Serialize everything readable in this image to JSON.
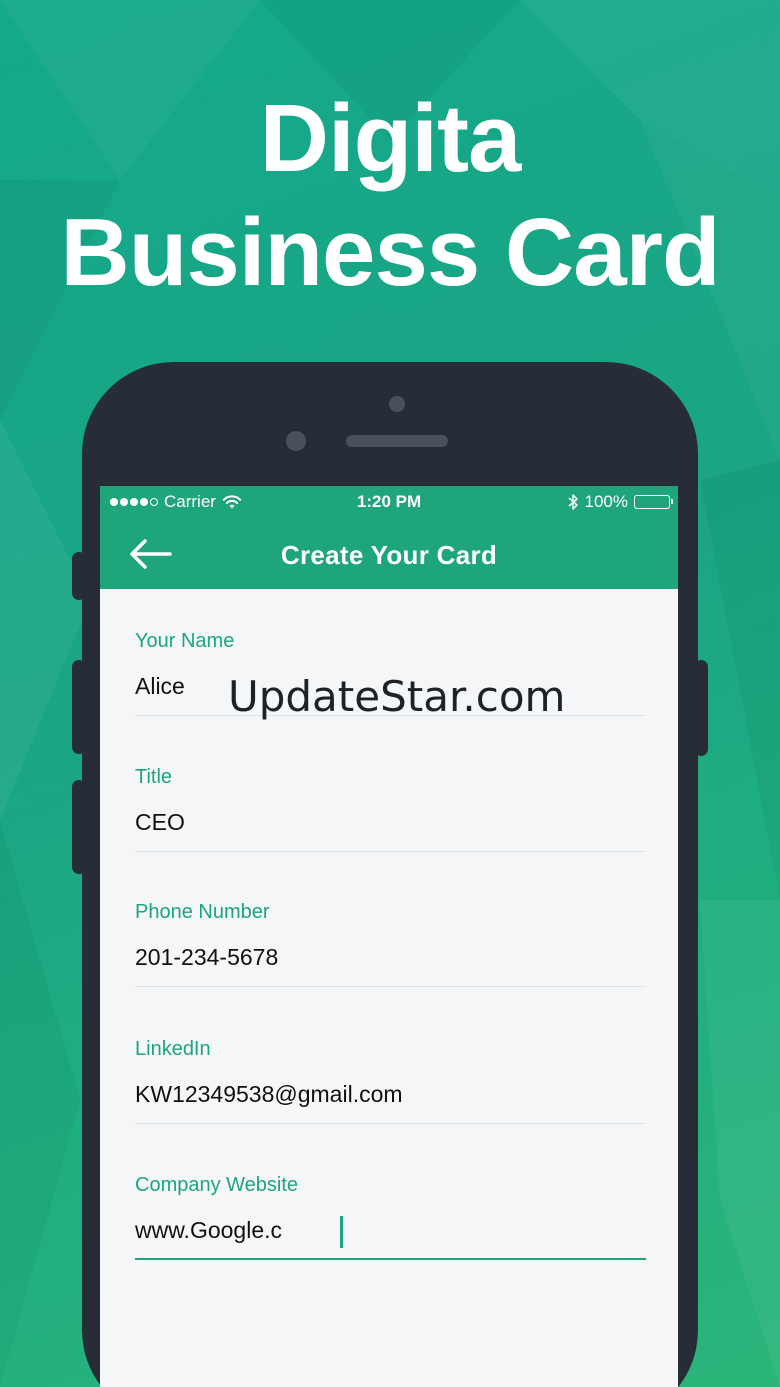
{
  "headline": {
    "line1": "Digita",
    "line2": "Business Card"
  },
  "status_bar": {
    "carrier": "Carrier",
    "time": "1:20 PM",
    "battery": "100%"
  },
  "nav": {
    "title": "Create Your Card",
    "back_icon": "arrow-left-icon"
  },
  "form": {
    "fields": [
      {
        "label": "Your Name",
        "value": "Alice"
      },
      {
        "label": "Title",
        "value": "CEO"
      },
      {
        "label": "Phone Number",
        "value": "201-234-5678"
      },
      {
        "label": "LinkedIn",
        "value": "KW12349538@gmail.com"
      },
      {
        "label": "Company Website",
        "value": "www.Google.c"
      }
    ]
  },
  "watermark": "UpdateStar.com",
  "colors": {
    "accent": "#1ea57c",
    "phone_body": "#272d36",
    "screen_bg": "#f4f6f8"
  }
}
